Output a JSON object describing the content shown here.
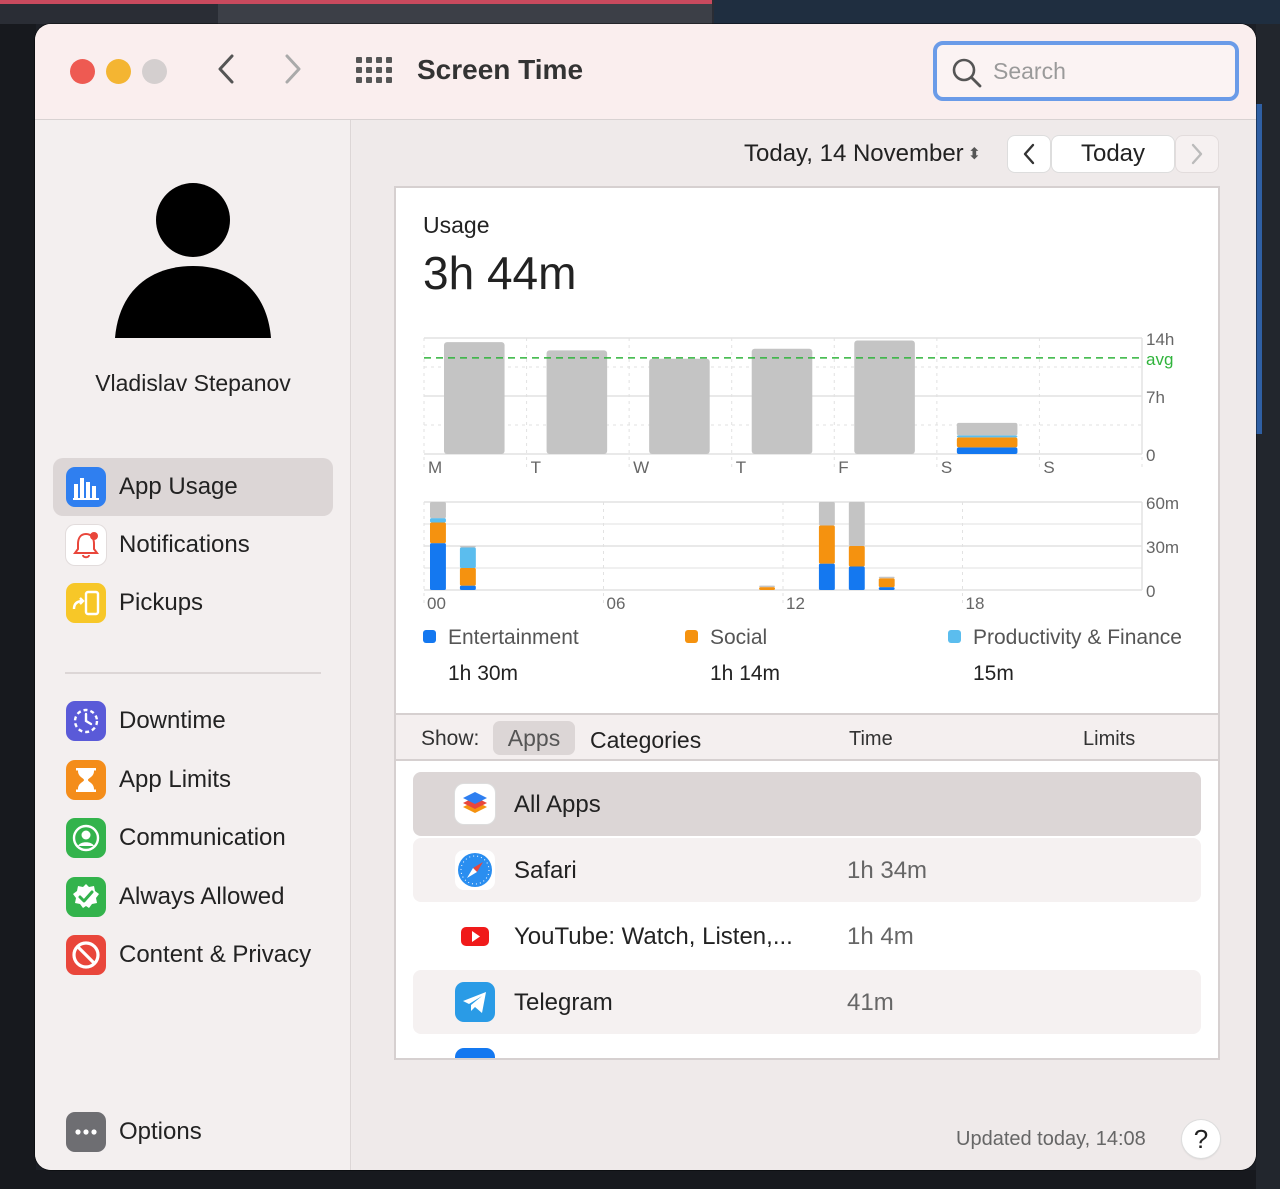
{
  "window": {
    "title": "Screen Time",
    "search_placeholder": "Search"
  },
  "user": {
    "name": "Vladislav Stepanov"
  },
  "sidebar": {
    "items": [
      {
        "label": "App Usage",
        "icon": "bar-chart-icon",
        "color": "#2f7ff0"
      },
      {
        "label": "Notifications",
        "icon": "bell-icon",
        "color": "#e9463b"
      },
      {
        "label": "Pickups",
        "icon": "pickup-icon",
        "color": "#f7c728"
      },
      {
        "label": "Downtime",
        "icon": "downtime-icon",
        "color": "#5a5ad8"
      },
      {
        "label": "App Limits",
        "icon": "hourglass-icon",
        "color": "#f48d1a"
      },
      {
        "label": "Communication",
        "icon": "person-circle-icon",
        "color": "#33b34c"
      },
      {
        "label": "Always Allowed",
        "icon": "check-shield-icon",
        "color": "#33b34c"
      },
      {
        "label": "Content & Privacy",
        "icon": "prohibited-icon",
        "color": "#e9463b"
      }
    ],
    "options_label": "Options"
  },
  "date": {
    "label": "Today, 14 November",
    "today_button": "Today"
  },
  "usage": {
    "label": "Usage",
    "total": "3h 44m"
  },
  "categories": [
    {
      "name": "Entertainment",
      "time": "1h 30m",
      "color": "#1478f0"
    },
    {
      "name": "Social",
      "time": "1h 14m",
      "color": "#f5920f"
    },
    {
      "name": "Productivity & Finance",
      "time": "15m",
      "color": "#5bbdee"
    }
  ],
  "chart_data": [
    {
      "type": "bar",
      "categories": [
        "M",
        "T",
        "W",
        "T",
        "F",
        "S",
        "S"
      ],
      "series": [
        {
          "name": "",
          "values": [
            13.5,
            12.5,
            11.5,
            12.7,
            13.7,
            0,
            0
          ]
        },
        {
          "name": "Entertainment",
          "values": [
            0,
            0,
            0,
            0,
            0,
            0.8,
            0
          ]
        },
        {
          "name": "Social",
          "values": [
            0,
            0,
            0,
            0,
            0,
            1.2,
            0
          ]
        },
        {
          "name": "Productivity & Finance",
          "values": [
            0,
            0,
            0,
            0,
            0,
            0.25,
            0
          ]
        },
        {
          "name": "",
          "values": [
            0,
            0,
            0,
            0,
            0,
            1.5,
            0
          ]
        }
      ],
      "y_tick_labels": [
        "14h",
        "7h",
        "0"
      ],
      "ylim": [
        0,
        14
      ],
      "average": 11.6,
      "average_label": "avg",
      "average_color": "#30b43c"
    },
    {
      "type": "bar",
      "x_tick_labels": [
        "00",
        "06",
        "12",
        "18"
      ],
      "x_range": [
        0,
        24
      ],
      "series": [
        {
          "name": "Entertainment",
          "hours": [
            0,
            1,
            13,
            14,
            15
          ],
          "values": [
            32,
            3,
            18,
            16,
            2
          ]
        },
        {
          "name": "Social",
          "hours": [
            0,
            1,
            11,
            13,
            14,
            15
          ],
          "values": [
            14,
            12,
            2,
            26,
            14,
            6
          ]
        },
        {
          "name": "Productivity & Finance",
          "hours": [
            0,
            1
          ],
          "values": [
            3,
            14
          ]
        },
        {
          "name": "",
          "hours": [
            0,
            1,
            11,
            13,
            14,
            15
          ],
          "values": [
            11,
            1,
            1,
            16,
            30,
            1
          ]
        }
      ],
      "y_tick_labels": [
        "60m",
        "30m",
        "0"
      ],
      "ylim": [
        0,
        60
      ]
    }
  ],
  "list": {
    "show_label": "Show:",
    "apps_tab": "Apps",
    "categories_tab": "Categories",
    "time_header": "Time",
    "limits_header": "Limits",
    "rows": [
      {
        "name": "All Apps",
        "time": "",
        "icon": "stack-icon"
      },
      {
        "name": "Safari",
        "time": "1h 34m",
        "icon": "compass-icon"
      },
      {
        "name": "YouTube: Watch, Listen,...",
        "time": "1h 4m",
        "icon": "play-icon"
      },
      {
        "name": "Telegram",
        "time": "41m",
        "icon": "paper-plane-icon"
      }
    ]
  },
  "footer": {
    "updated": "Updated today, 14:08",
    "help": "?"
  },
  "colors": {
    "gray_bar": "#c4c4c4",
    "grid": "#e2e2e2",
    "axis_label": "#666666"
  }
}
